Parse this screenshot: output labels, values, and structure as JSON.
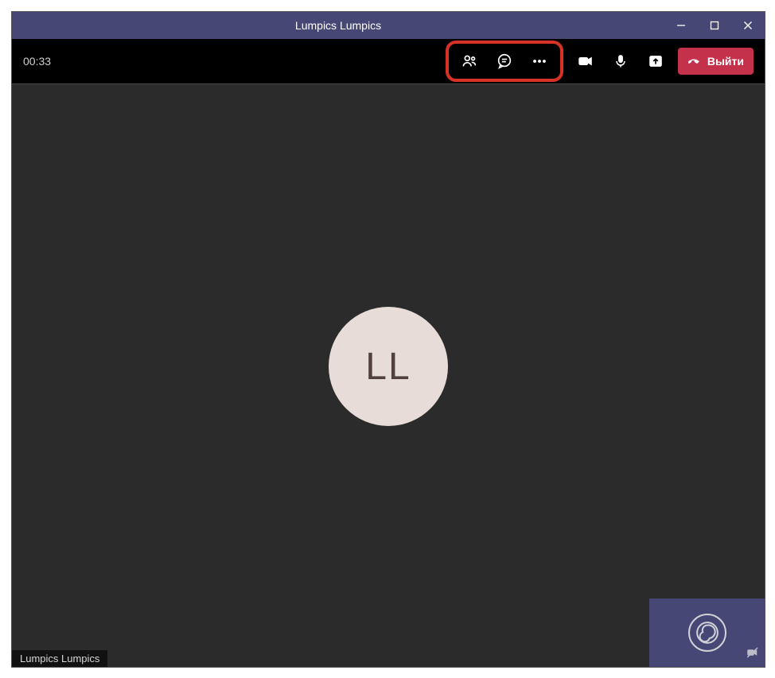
{
  "titlebar": {
    "title": "Lumpics Lumpics"
  },
  "toolbar": {
    "timer": "00:33",
    "leave_label": "Выйти"
  },
  "stage": {
    "avatar_initials": "LL",
    "participant_name": "Lumpics Lumpics"
  }
}
